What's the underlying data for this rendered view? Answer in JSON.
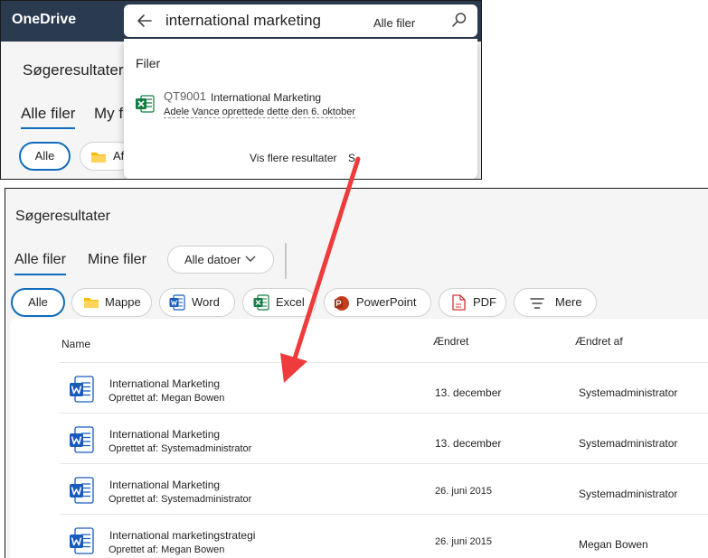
{
  "colors": {
    "accent": "#0f6cbd",
    "topbar": "#2a3a4f",
    "arrow": "#ef3b3b",
    "word": "#185abd",
    "excel": "#107c41",
    "powerpoint": "#c43e1c",
    "pdf": "#d13438",
    "folder": "#ffb900"
  },
  "top": {
    "app_title": "OneDrive",
    "search": {
      "query": "international marketing",
      "scope": "Alle filer",
      "back_icon": "arrow-left-icon",
      "search_icon": "search-icon"
    },
    "underlay": {
      "title": "Søgeresultater",
      "tab_all": "Alle filer",
      "tab_mine_cut": "My f",
      "chip_all": "Alle",
      "chip_folder_cut": "Af"
    },
    "dropdown": {
      "section": "Filer",
      "item": {
        "code": "QT9001",
        "name": "International Marketing",
        "subtitle": "Adele Vance oprettede dette den 6. oktober",
        "icon": "excel-icon"
      },
      "more": "Vis flere resultater",
      "more_cut": "S"
    }
  },
  "bottom": {
    "title": "Søgeresultater",
    "tabs": [
      "Alle filer",
      "Mine filer"
    ],
    "date_filter": "Alle datoer",
    "chips": [
      "Alle",
      "Mappe",
      "Word",
      "Excel",
      "PowerPoint",
      "PDF",
      "Mere"
    ],
    "columns": {
      "name": "Name",
      "modified": "Ændret",
      "modified_by": "Ændret af"
    },
    "rows": [
      {
        "name": "International Marketing",
        "sub": "Oprettet af: Megan Bowen",
        "modified": "13. december",
        "by": "Systemadministrator"
      },
      {
        "name": "International Marketing",
        "sub": "Oprettet af: Systemadministrator",
        "modified": "13. december",
        "by": "Systemadministrator"
      },
      {
        "name": "International Marketing",
        "sub": "Oprettet af: Systemadministrator",
        "modified": "26. juni 2015",
        "by": "Systemadministrator"
      },
      {
        "name": "International marketingstrategi",
        "sub": "Oprettet af: Megan Bowen",
        "modified": "26. juni 2015",
        "by": "Megan Bowen"
      }
    ]
  }
}
